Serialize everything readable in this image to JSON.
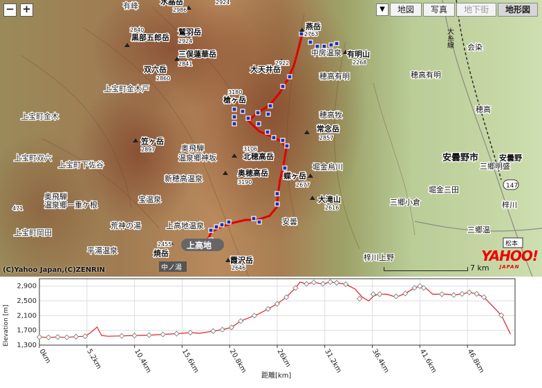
{
  "map": {
    "zoom_in": "+",
    "zoom_out": "−",
    "arrow": "▼",
    "tabs": [
      {
        "label": "地図",
        "state": "normal"
      },
      {
        "label": "写真",
        "state": "normal"
      },
      {
        "label": "地下街",
        "state": "disabled"
      },
      {
        "label": "地形図",
        "state": "active"
      }
    ],
    "copyright": "(C)Yahoo Japan,(C)ZENRIN",
    "scale_label": "7 km",
    "logo": "YAHOO!",
    "logo_sub": "JAPAN",
    "labels": [
      {
        "t": "水晶岳"
      },
      {
        "t": "2986"
      },
      {
        "t": "2924"
      },
      {
        "t": "有峰"
      },
      {
        "t": "燕岳"
      },
      {
        "t": "2763"
      },
      {
        "t": "2840"
      },
      {
        "t": "黒部五郎岳"
      },
      {
        "t": "2924"
      },
      {
        "t": "鷲羽岳"
      },
      {
        "t": "三俣蓮華岳"
      },
      {
        "t": "2841"
      },
      {
        "t": "双六岳"
      },
      {
        "t": "2860"
      },
      {
        "t": "中房温泉"
      },
      {
        "t": "有明山"
      },
      {
        "t": "2268"
      },
      {
        "t": "2922"
      },
      {
        "t": "大天井岳"
      },
      {
        "t": "上宝町金木戸"
      },
      {
        "t": "3180"
      },
      {
        "t": "槍ヶ岳"
      },
      {
        "t": "穂高有明"
      },
      {
        "t": "穂高牧"
      },
      {
        "t": "常念岳"
      },
      {
        "t": "2857"
      },
      {
        "t": "上宝町金木"
      },
      {
        "t": "笠ヶ岳"
      },
      {
        "t": "2897"
      },
      {
        "t": "奥飛騨"
      },
      {
        "t": "温泉郷神坂"
      },
      {
        "t": "3106"
      },
      {
        "t": "北穂高岳"
      },
      {
        "t": "上宝町下佐谷"
      },
      {
        "t": "奥穂高岳"
      },
      {
        "t": "3190"
      },
      {
        "t": "蝶ヶ岳"
      },
      {
        "t": "2677"
      },
      {
        "t": "堀金烏川"
      },
      {
        "t": "新穂高温泉"
      },
      {
        "t": "宝温泉"
      },
      {
        "t": "大滝山"
      },
      {
        "t": "2616"
      },
      {
        "t": "奥飛騨"
      },
      {
        "t": "温泉郷一重ケ根"
      },
      {
        "t": "荒神の湯"
      },
      {
        "t": "上高地温泉"
      },
      {
        "t": "安曇"
      },
      {
        "t": "2455"
      },
      {
        "t": "焼岳"
      },
      {
        "t": "上高地"
      },
      {
        "t": "霞沢岳"
      },
      {
        "t": "2646"
      },
      {
        "t": "中ノ湯"
      },
      {
        "t": "平湯温泉"
      },
      {
        "t": "安曇野市"
      },
      {
        "t": "穂高"
      },
      {
        "t": "穂高有明"
      },
      {
        "t": "会染"
      },
      {
        "t": "大糸線"
      },
      {
        "t": "三郷明盛"
      },
      {
        "t": "堀金三田"
      },
      {
        "t": "梓川"
      },
      {
        "t": "三郷小倉"
      },
      {
        "t": "松本"
      },
      {
        "t": "梓川上野"
      },
      {
        "t": "三郷温"
      },
      {
        "t": "安曇野"
      },
      {
        "t": "147"
      },
      {
        "t": "471"
      },
      {
        "t": "上宝町双六"
      },
      {
        "t": "上宝町岡田"
      }
    ]
  },
  "chart_data": {
    "type": "line",
    "xlabel": "距離[km]",
    "ylabel": "Elevation [m]",
    "ylim": [
      1300,
      3100
    ],
    "xlim": [
      0,
      52
    ],
    "yticks": [
      "1,300",
      "1,700",
      "2,100",
      "2,500",
      "2,900"
    ],
    "xticks": [
      "0km",
      "5.2km",
      "10.4km",
      "15.6km",
      "20.8km",
      "26km",
      "31.2km",
      "36.4km",
      "41.6km",
      "46.8km"
    ],
    "series": [
      {
        "color": "#e41a1c",
        "x": [
          0,
          1,
          2,
          3,
          4,
          5,
          5.5,
          6.3,
          6.8,
          7.5,
          9,
          10.4,
          12,
          13.5,
          15,
          16.5,
          17.5,
          19,
          20,
          21,
          22,
          23,
          24,
          25,
          26,
          27,
          28,
          28.5,
          29.2,
          30,
          31,
          31.8,
          32.5,
          33.5,
          34.5,
          35.3,
          36,
          36.5,
          37,
          38,
          39,
          40,
          41,
          41.6,
          42,
          43,
          44.5,
          45.3,
          46.2,
          47,
          47.8,
          48.6,
          49.5,
          50.5,
          51.5
        ],
        "y": [
          1520,
          1510,
          1520,
          1510,
          1530,
          1540,
          1620,
          1790,
          1560,
          1540,
          1550,
          1560,
          1570,
          1590,
          1610,
          1640,
          1620,
          1680,
          1720,
          1780,
          1950,
          2050,
          2150,
          2280,
          2420,
          2600,
          2850,
          3010,
          2960,
          3000,
          2960,
          3010,
          2990,
          2950,
          2820,
          2600,
          2500,
          2620,
          2680,
          2680,
          2600,
          2700,
          2850,
          2900,
          2900,
          2680,
          2680,
          2660,
          2690,
          2730,
          2690,
          2600,
          2370,
          2110,
          1600
        ]
      }
    ],
    "markers_x": [
      0,
      1,
      2,
      3,
      4,
      5,
      9,
      10.4,
      12,
      13.5,
      15,
      16.5,
      19,
      20,
      21,
      22,
      23.5,
      25,
      26,
      27,
      28,
      29.2,
      30,
      31,
      31.8,
      32.5,
      33.5,
      35,
      36.5,
      37.2,
      39,
      40,
      41,
      41.6,
      42,
      44,
      45.3,
      46.2,
      47,
      47.8,
      48.6,
      50.5
    ],
    "markers_y": [
      1520,
      1510,
      1520,
      1510,
      1530,
      1540,
      1550,
      1560,
      1570,
      1590,
      1610,
      1640,
      1680,
      1720,
      1780,
      1950,
      2100,
      2280,
      2420,
      2600,
      2850,
      2960,
      3000,
      2960,
      3010,
      2990,
      2950,
      2560,
      2680,
      2680,
      2620,
      2700,
      2850,
      2900,
      2850,
      2680,
      2660,
      2690,
      2730,
      2690,
      2600,
      2110
    ]
  }
}
